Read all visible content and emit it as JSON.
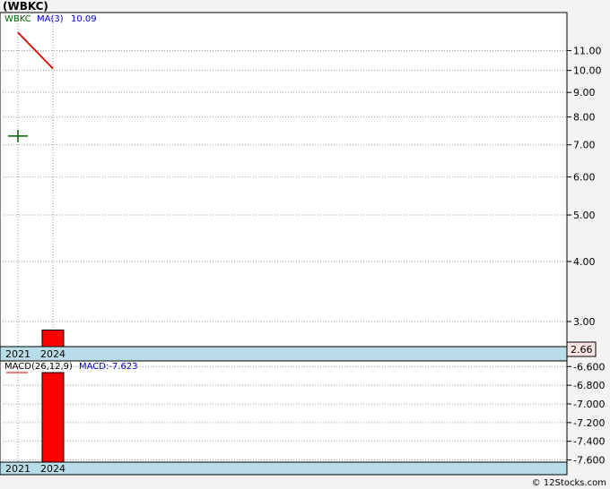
{
  "title": "(WBKC)",
  "credit": "© 12Stocks.com",
  "colors": {
    "price": "#006400",
    "ma": "#e00000",
    "bar": "#ff0000",
    "legend_text": "#0000cc",
    "grid": "#999999",
    "axis_band": "#b8dde8",
    "last_price_box": "#ffe4e4"
  },
  "chart_data": [
    {
      "type": "line",
      "panel": "price",
      "scale": "log",
      "x_categories": [
        "2021",
        "2024"
      ],
      "legend": {
        "symbol": "WBKC",
        "ma_label": "MA(3)",
        "ma_value": "10.09"
      },
      "series": [
        {
          "name": "WBKC",
          "style": "ohlc-tick",
          "points": [
            {
              "x": "2021",
              "y": 7.3
            }
          ]
        },
        {
          "name": "MA(3)",
          "style": "line",
          "points": [
            {
              "x": "2021",
              "y": 12.0
            },
            {
              "x": "2024",
              "y": 10.09
            }
          ]
        }
      ],
      "volume_bar": {
        "x": "2024",
        "y_top": 2.88,
        "y_bottom": 2.66
      },
      "yticks": [
        11,
        10,
        9,
        8,
        7,
        6,
        5,
        4,
        3
      ],
      "ytick_labels": [
        "11.00",
        "10.00",
        "9.00",
        "8.00",
        "7.00",
        "6.00",
        "5.00",
        "4.00",
        "3.00"
      ],
      "ylim": [
        2.66,
        13.2
      ],
      "last_price": "2.66",
      "grid": true
    },
    {
      "type": "bar",
      "panel": "macd",
      "x_categories": [
        "2021",
        "2024"
      ],
      "legend": {
        "label": "MACD(26,12,9)",
        "value_label": "MACD:-7.623"
      },
      "series": [
        {
          "name": "MACD",
          "points": [
            {
              "x": "2024",
              "y": -7.623
            }
          ]
        }
      ],
      "yticks": [
        -6.6,
        -6.8,
        -7.0,
        -7.2,
        -7.4,
        -7.6
      ],
      "ytick_labels": [
        "-6.600",
        "-6.800",
        "-7.000",
        "-7.200",
        "-7.400",
        "-7.600"
      ],
      "ylim": [
        -7.623,
        -6.54
      ],
      "grid": true
    }
  ]
}
